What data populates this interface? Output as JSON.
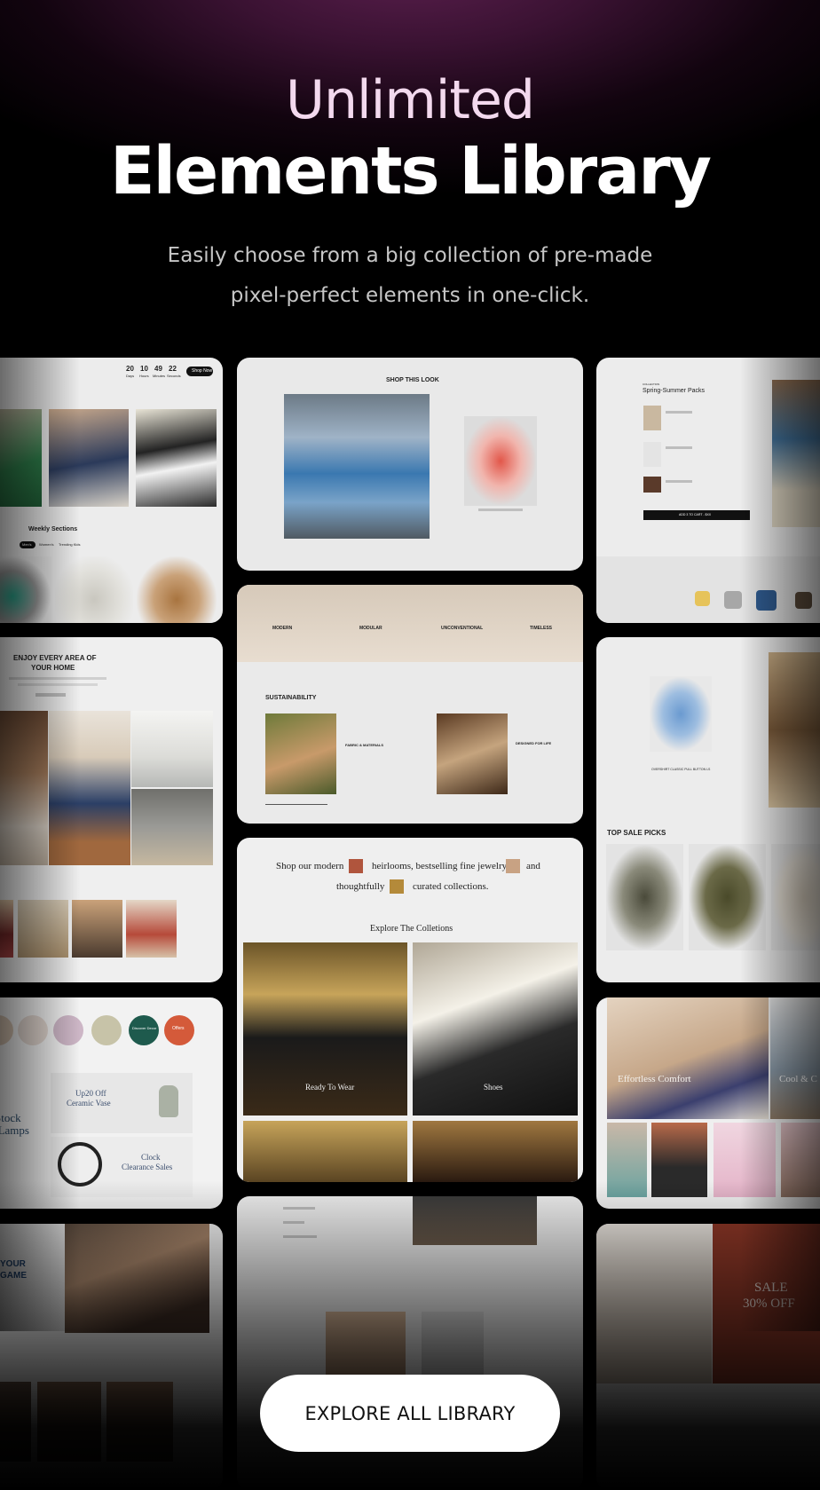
{
  "hero": {
    "title_line1": "Unlimited",
    "title_line2": "Elements Library",
    "subtitle": "Easily choose from a big collection of pre-made pixel-perfect elements in one-click."
  },
  "cta": {
    "label": "EXPLORE ALL LIBRARY"
  },
  "cards": {
    "countdown": {
      "values": [
        "20",
        "10",
        "49",
        "22"
      ],
      "units": [
        "Days",
        "Hours",
        "Minutes",
        "Seconds"
      ],
      "button": "Shop Now",
      "section_title": "Weekly Sections",
      "tabs": [
        "Men's",
        "Women's",
        "Trending Kids"
      ]
    },
    "shop_look": {
      "title": "SHOP THIS LOOK"
    },
    "packs": {
      "label": "COLLECTION",
      "title": "Spring-Summer Packs",
      "button": "ADD 3 TO CART - $XX"
    },
    "features": {
      "items": [
        "MODERN",
        "MODULAR",
        "UNCONVENTIONAL",
        "TIMELESS"
      ]
    },
    "sustainability": {
      "title": "SUSTAINABILITY",
      "items": [
        "FABRIC & MATERIALS",
        "DESIGNED FOR LIFE"
      ]
    },
    "home": {
      "title_line1": "ENJOY EVERY AREA OF",
      "title_line2": "YOUR HOME"
    },
    "shirt": {
      "product": "OVERSHIRT CLASSIC PULL BUTTON LS"
    },
    "sale_picks": {
      "title": "TOP SALE PICKS"
    },
    "jewelry": {
      "line1_a": "Shop our modern",
      "line1_b": "heirlooms, bestselling fine jewelry",
      "line1_c": "and",
      "line2_a": "thoughtfully",
      "line2_b": "curated collections.",
      "explore_title": "Explore The Colletions",
      "tiles": [
        "Ready To Wear",
        "Shoes"
      ]
    },
    "decor": {
      "promo1_line1": "Up20 Off",
      "promo1_line2": "Ceramic Vase",
      "promo2_line1": "Clock",
      "promo2_line2": "Clearance Sales",
      "side_text_1": "Stock",
      "side_text_2": "r Lamps",
      "circle_label": "Discover Decor",
      "circle_label_2": "Offers"
    },
    "comfort": {
      "title": "Effortless Comfort",
      "right": "Cool & C"
    },
    "game": {
      "line1": "YOUR",
      "line2": "GAME"
    },
    "sale30": {
      "line1": "SALE",
      "line2": "30% OFF"
    }
  },
  "colors": {
    "accent": "#5b1f4e",
    "page_bg": "#000000"
  }
}
